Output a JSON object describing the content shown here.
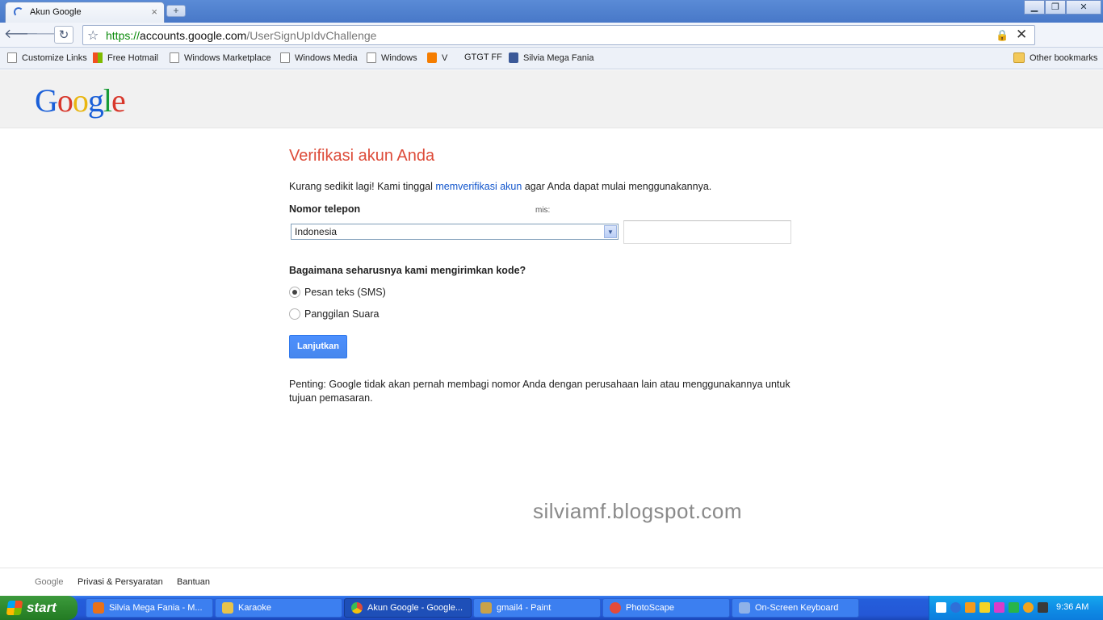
{
  "browser": {
    "tab_title": "Akun Google",
    "tab_close": "×",
    "new_tab": "+",
    "url_scheme": "https://",
    "url_host": "accounts.google.com",
    "url_path": "/UserSignUpIdvChallenge",
    "bookmarks": [
      {
        "label": "Customize Links",
        "icon": "page"
      },
      {
        "label": "Free Hotmail",
        "icon": "windows-logo"
      },
      {
        "label": "Windows Marketplace",
        "icon": "page"
      },
      {
        "label": "Windows Media",
        "icon": "page"
      },
      {
        "label": "Windows",
        "icon": "page"
      },
      {
        "label": "V",
        "icon": "blogger-logo"
      },
      {
        "label": "GTGT FF",
        "icon": "none"
      },
      {
        "label": "Silvia Mega Fania",
        "icon": "facebook-logo"
      }
    ],
    "other_bookmarks": "Other bookmarks"
  },
  "page": {
    "logo": {
      "G": "G",
      "o1": "o",
      "o2": "o",
      "g": "g",
      "l": "l",
      "e": "e"
    },
    "title": "Verifikasi akun Anda",
    "intro_before": "Kurang sedikit lagi! Kami tinggal ",
    "intro_link": "memverifikasi akun",
    "intro_after": " agar Anda dapat mulai menggunakannya.",
    "phone_label": "Nomor telepon",
    "example_label": "mis:",
    "country_selected": "Indonesia",
    "phone_value": "",
    "method_question": "Bagaimana seharusnya kami mengirimkan kode?",
    "method_options": [
      {
        "label": "Pesan teks (SMS)",
        "selected": true
      },
      {
        "label": "Panggilan Suara",
        "selected": false
      }
    ],
    "continue_label": "Lanjutkan",
    "note": "Penting: Google tidak akan pernah membagi nomor Anda dengan perusahaan lain atau menggunakannya untuk tujuan pemasaran.",
    "watermark": "silviamf.blogspot.com"
  },
  "footer": {
    "google": "Google",
    "privacy": "Privasi & Persyaratan",
    "help": "Bantuan"
  },
  "taskbar": {
    "start_label": "start",
    "tasks": [
      {
        "label": "Silvia Mega Fania - M...",
        "icon_color": "#e8711a",
        "active": false
      },
      {
        "label": "Karaoke",
        "icon_color": "#e8c34a",
        "active": false
      },
      {
        "label": "Akun Google - Google...",
        "icon_color": "#dd4b39",
        "active": true
      },
      {
        "label": "gmail4 - Paint",
        "icon_color": "#c9a24a",
        "active": false
      },
      {
        "label": "PhotoScape",
        "icon_color": "#e44b3a",
        "active": false
      },
      {
        "label": "On-Screen Keyboard",
        "icon_color": "#8fb2e8",
        "active": false
      }
    ],
    "clock": "9:36 AM"
  },
  "colors": {
    "title_red": "#dd4b39",
    "link_blue": "#1155cc",
    "button_blue": "#4d90fe"
  }
}
